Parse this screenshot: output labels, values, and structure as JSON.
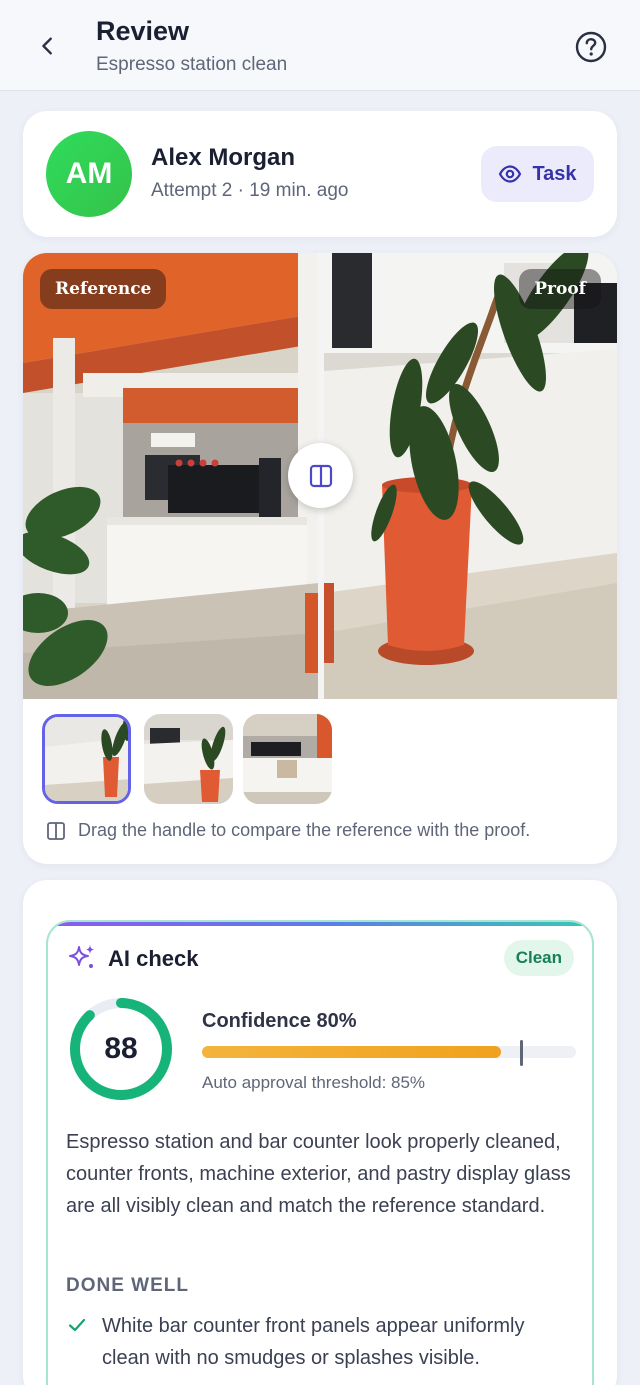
{
  "header": {
    "title": "Review",
    "subtitle": "Espresso station clean",
    "back_icon": "chevron-left-icon",
    "help_icon": "help-circle-icon"
  },
  "user": {
    "initials": "AM",
    "name": "Alex Morgan",
    "meta": "Attempt 2 · 19 min. ago",
    "task_label": "Task",
    "task_icon": "eye-icon"
  },
  "compare": {
    "reference_label": "Reference",
    "proof_label": "Proof",
    "handle_icon": "split-columns-icon",
    "thumbnails_count_selected": 0,
    "hint": "Drag the handle to compare the reference with the proof."
  },
  "ai_check": {
    "title": "AI check",
    "status": "Clean",
    "score": "88",
    "score_value": 88,
    "confidence_label": "Confidence 80%",
    "confidence_value": 80,
    "threshold_value": 85,
    "threshold_text": "Auto approval threshold: 85%",
    "summary": "Espresso station and bar counter look properly cleaned, counter fronts, machine exterior, and pastry display glass are all visibly clean and match the reference standard.",
    "done_well_heading": "DONE WELL",
    "done_well_items": [
      "White bar counter front panels appear uniformly clean with no smudges or splashes visible."
    ],
    "colors": {
      "accent": "#6362e8",
      "success": "#17a56c",
      "confidence": "#f0a21e"
    }
  }
}
